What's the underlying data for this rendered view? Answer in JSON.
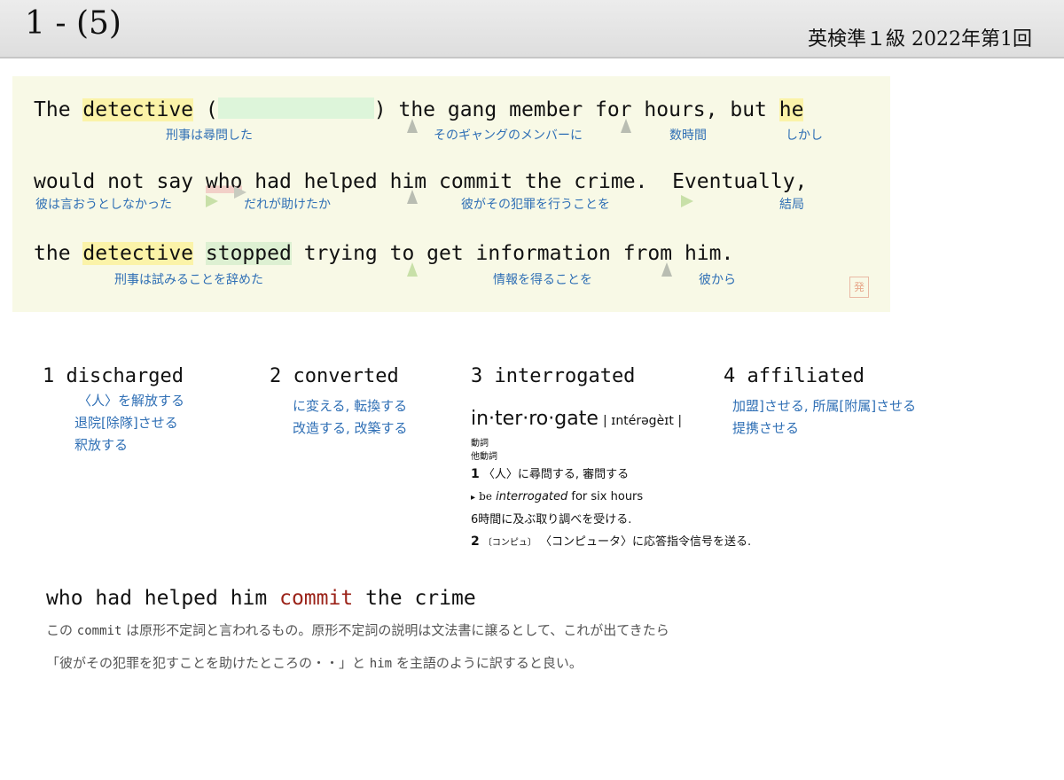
{
  "header": {
    "slide_number": "1 - (5)",
    "exam": "英検準１級  2022年第1回"
  },
  "sentence": {
    "line1": {
      "w_the": "The",
      "w_detective": "detective",
      "w_open": "(",
      "w_close": ")",
      "w_rest": "the gang member for hours, but",
      "w_he": "he"
    },
    "line2": {
      "w_would": "would not say",
      "w_who": "who",
      "w_rest": "had helped him commit the crime.  Eventually,"
    },
    "line3": {
      "w_the": "the",
      "w_detective": "detective",
      "w_stopped": "stopped",
      "w_rest": "trying to get information from him."
    },
    "glosses": {
      "g1": "刑事は尋問した",
      "g2": "そのギャングのメンバーに",
      "g3": "数時間",
      "g4": "しかし",
      "g5": "彼は言おうとしなかった",
      "g6": "だれが助けたか",
      "g7": "彼がその犯罪を行うことを",
      "g8": "結局",
      "g9": "刑事は試みることを辞めた",
      "g10": "情報を得ることを",
      "g11": "彼から"
    },
    "stamp_char": "発"
  },
  "choices": {
    "c1": {
      "label": "1 discharged",
      "meanings": [
        "〈人〉を解放する",
        "退院[除隊]させる",
        "釈放する"
      ]
    },
    "c2": {
      "label": "2 converted",
      "meanings": [
        "に変える, 転換する",
        "改造する, 改築する"
      ]
    },
    "c3": {
      "label": "3 interrogated"
    },
    "c4": {
      "label": "4 affiliated",
      "meanings": [
        "加盟]させる, 所属[附属]させる",
        "提携させる"
      ]
    }
  },
  "dictionary": {
    "headword": "in·ter·ro·gate",
    "pronunciation": "| ɪntérəgèɪt |",
    "pos1": "動詞",
    "pos2": "他動詞",
    "sense1_num": "1",
    "sense1": "〈人〉に尋問する, 審問する",
    "example_arrow": "▸",
    "example_be": "be",
    "example_word": "interrogated",
    "example_rest": "for six hours",
    "example_ja": "6時間に及ぶ取り調べを受ける.",
    "sense2_num": "2",
    "sense2_label": "〔コンピュ〕",
    "sense2": "〈コンピュータ〉に応答指令信号を送る."
  },
  "explanation": {
    "title_a": "who had helped him",
    "title_commit": "commit",
    "title_b": "the crime",
    "line1_a": "この",
    "line1_code": "commit",
    "line1_b": "は原形不定詞と言われるもの。原形不定詞の説明は文法書に譲るとして、これが出てきたら",
    "line2_a": "「彼がその犯罪を犯すことを助けたところの・・」と",
    "line2_code": "him",
    "line2_b": "を主語のように訳すると良い。"
  },
  "colors": {
    "header_bg": "#e4e4e4",
    "sentence_bg": "#f8f9e6",
    "highlight_yellow": "#fbf3a8",
    "blank_green": "#ddf5da",
    "gloss_blue": "#2f6fb5",
    "commit_red": "#9b2218"
  }
}
